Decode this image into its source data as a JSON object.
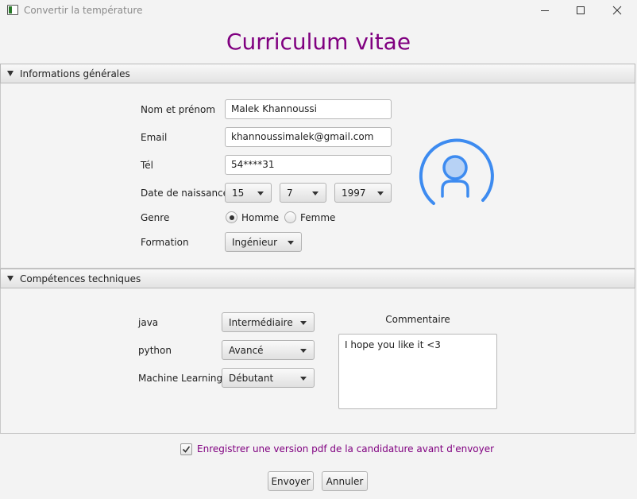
{
  "window": {
    "title": "Convertir la température",
    "icon": "app-window-icon"
  },
  "page_title": "Curriculum vitae",
  "colors": {
    "title": "#800080",
    "avatar": "#3d8bf0",
    "avatar_fill": "#b7d2f5"
  },
  "general": {
    "pane_title": "Informations générales",
    "name_label": "Nom et prénom",
    "name_value": "Malek Khannoussi",
    "email_label": "Email",
    "email_value": "khannoussimalek@gmail.com",
    "tel_label": "Tél",
    "tel_value": "54****31",
    "birth_label": "Date de naissance",
    "birth_day": "15",
    "birth_month": "7",
    "birth_year": "1997",
    "gender_label": "Genre",
    "gender_options": [
      "Homme",
      "Femme"
    ],
    "gender_selected": "Homme",
    "formation_label": "Formation",
    "formation_value": "Ingénieur",
    "avatar_icon": "user-avatar-icon"
  },
  "skills": {
    "pane_title": "Compétences techniques",
    "items": [
      {
        "label": "java",
        "level": "Intermédiaire"
      },
      {
        "label": "python",
        "level": "Avancé"
      },
      {
        "label": "Machine Learning",
        "level": "Débutant"
      }
    ],
    "comment_label": "Commentaire",
    "comment_value": "I hope you like it <3"
  },
  "pdf_checkbox": {
    "label": "Enregistrer une version pdf de la candidature avant d'envoyer",
    "checked": true
  },
  "buttons": {
    "send": "Envoyer",
    "cancel": "Annuler"
  }
}
